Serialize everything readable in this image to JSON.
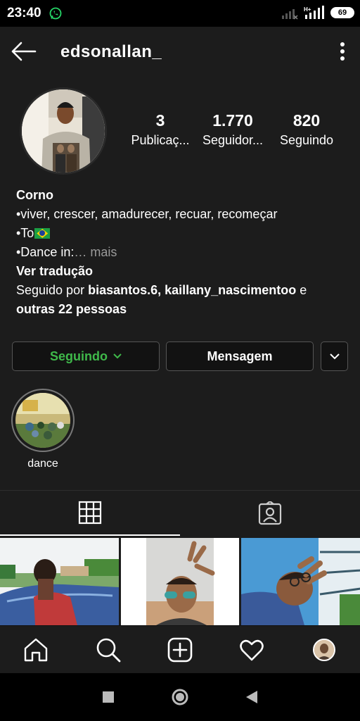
{
  "status_bar": {
    "time": "23:40",
    "battery": "69",
    "signal_1": "atl",
    "network_type": "H+"
  },
  "header": {
    "username": "edsonallan_"
  },
  "stats": [
    {
      "value": "3",
      "label": "Publicaç..."
    },
    {
      "value": "1.770",
      "label": "Seguidor..."
    },
    {
      "value": "820",
      "label": "Seguindo"
    }
  ],
  "bio": {
    "name": "Corno",
    "line1": "•viver, crescer, amadurecer, recuar, recomeçar",
    "line2_prefix": "•To",
    "line3_prefix": "•Dance in:",
    "line3_more": "… mais",
    "translate": "Ver tradução",
    "followed_by_prefix": "Seguido por ",
    "followed_by_users": "biasantos.6, kaillany_nascimentoo",
    "followed_by_and": " e",
    "followed_by_others": "outras 22 pessoas"
  },
  "actions": {
    "following_label": "Seguindo",
    "message_label": "Mensagem"
  },
  "highlights": [
    {
      "label": "dance"
    }
  ],
  "colors": {
    "accent_green": "#3fb84a",
    "background": "#1c1c1c"
  },
  "icons": {
    "back": "arrow-left-icon",
    "more": "more-vertical-icon",
    "grid": "grid-icon",
    "tagged": "person-tag-icon",
    "home": "home-icon",
    "search": "search-icon",
    "add": "add-post-icon",
    "activity": "heart-icon"
  }
}
